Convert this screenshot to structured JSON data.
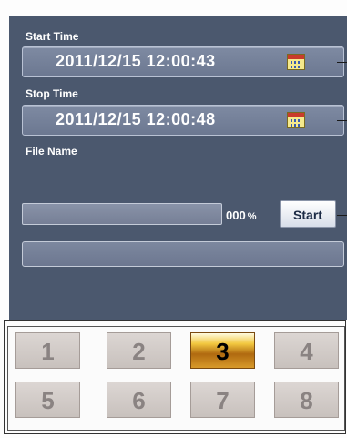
{
  "start_time": {
    "label": "Start Time",
    "value": "2011/12/15  12:00:43"
  },
  "stop_time": {
    "label": "Stop Time",
    "value": "2011/12/15  12:00:48"
  },
  "file_name": {
    "label": "File Name"
  },
  "progress": {
    "percent_text": "000",
    "percent_sign": "%",
    "value": 0
  },
  "start_button": {
    "label": "Start"
  },
  "channels": {
    "selected": "3",
    "items": [
      "1",
      "2",
      "3",
      "4",
      "5",
      "6",
      "7",
      "8"
    ]
  },
  "colors": {
    "panel": "#4b586e",
    "selected": "#f2c840"
  }
}
